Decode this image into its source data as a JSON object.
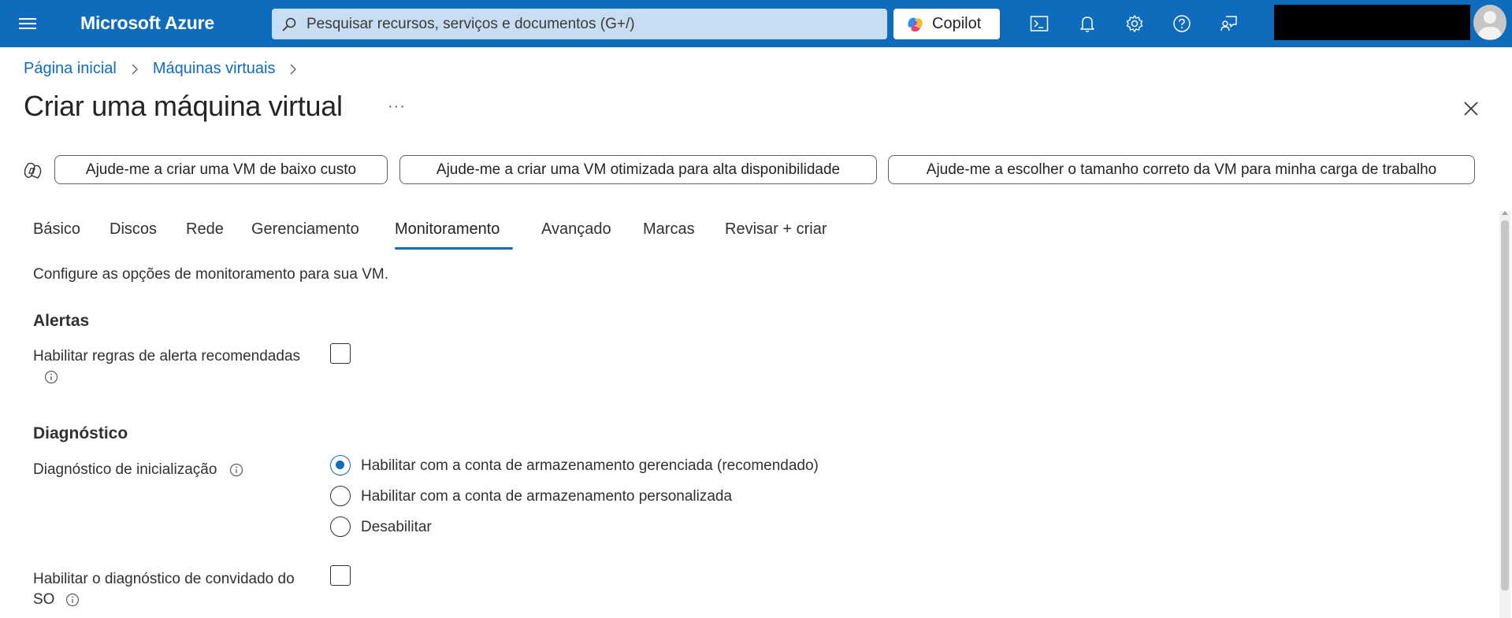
{
  "topbar": {
    "brand": "Microsoft Azure",
    "search_placeholder": "Pesquisar recursos, serviços e documentos (G+/)",
    "copilot_label": "Copilot",
    "icons": [
      "menu-icon",
      "cloud-shell-icon",
      "notifications-icon",
      "settings-icon",
      "help-icon",
      "feedback-icon"
    ],
    "accent_color": "#0f6cbd"
  },
  "breadcrumb": {
    "items": [
      "Página inicial",
      "Máquinas virtuais"
    ]
  },
  "page": {
    "title": "Criar uma máquina virtual",
    "more": "···"
  },
  "suggestions": [
    "Ajude-me a criar uma VM de baixo custo",
    "Ajude-me a criar uma VM otimizada para alta disponibilidade",
    "Ajude-me a escolher o tamanho correto da VM para minha carga de trabalho"
  ],
  "tabs": {
    "items": [
      "Básico",
      "Discos",
      "Rede",
      "Gerenciamento",
      "Monitoramento",
      "Avançado",
      "Marcas",
      "Revisar + criar"
    ],
    "active": "Monitoramento"
  },
  "content": {
    "description": "Configure as opções de monitoramento para sua VM.",
    "alerts": {
      "heading": "Alertas",
      "enable_rules_label": "Habilitar regras de alerta recomendadas",
      "enable_rules_checked": false
    },
    "diagnostics": {
      "heading": "Diagnóstico",
      "boot_label": "Diagnóstico de inicialização",
      "boot_options": [
        "Habilitar com a conta de armazenamento gerenciada (recomendado)",
        "Habilitar com a conta de armazenamento personalizada",
        "Desabilitar"
      ],
      "boot_selected": "Habilitar com a conta de armazenamento gerenciada (recomendado)",
      "guest_os_label_line1": "Habilitar o diagnóstico de convidado do",
      "guest_os_label_line2": "SO",
      "guest_os_checked": false
    }
  }
}
